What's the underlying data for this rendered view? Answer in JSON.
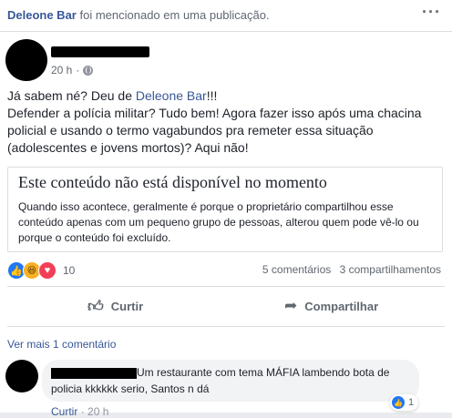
{
  "notice": {
    "page_name": "Deleone Bar",
    "text": " foi mencionado em uma publicação.",
    "more_label": "···"
  },
  "post": {
    "time": "20 h",
    "separator": "·",
    "text_before": "Já sabem né? Deu de ",
    "mention": "Deleone Bar",
    "text_after": "!!!\nDefender a polícia militar? Tudo bem! Agora fazer isso após uma chacina policial e usando o termo vagabundos pra remeter essa situação (adolescentes e jovens mortos)? Aqui não!",
    "unavailable": {
      "title": "Este conteúdo não está disponível no momento",
      "description": "Quando isso acontece, geralmente é porque o proprietário compartilhou esse conteúdo apenas com um pequeno grupo de pessoas, alterou quem pode vê-lo ou porque o conteúdo foi excluído."
    },
    "reactions": {
      "icons": [
        "like-icon",
        "haha-icon",
        "love-icon"
      ],
      "count": "10"
    },
    "stats": {
      "comments": "5 comentários",
      "shares": "3 compartilhamentos"
    },
    "actions": {
      "like": "Curtir",
      "share": "Compartilhar"
    }
  },
  "comments_section": {
    "more_label": "Ver mais 1 comentário",
    "comment": {
      "text": "Um restaurante com tema MÁFIA lambendo bota de policia kkkkkk serio, Santos n dá",
      "reaction_count": "1",
      "like_link": "Curtir",
      "separator": "·",
      "time": "20 h"
    }
  },
  "colors": {
    "link": "#385898",
    "like_blue": "#2078f4",
    "love_red": "#f33e58",
    "haha_yellow": "#f7b125",
    "background": "#e9ebee"
  }
}
